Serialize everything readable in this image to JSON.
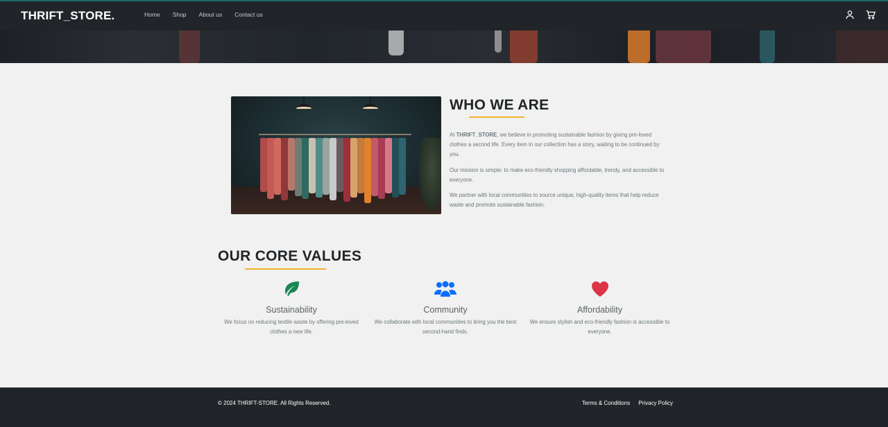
{
  "brand": "THRIFT_STORE.",
  "nav": {
    "links": [
      "Home",
      "Shop",
      "About us",
      "Contact us"
    ],
    "icons": [
      "user-icon",
      "cart-icon"
    ]
  },
  "about": {
    "title": "WHO WE ARE",
    "p1_prefix": "At ",
    "p1_brand": "THRIFT_STORE",
    "p1_rest": ", we believe in promoting sustainable fashion by giving pre-loved clothes a second life. Every item in our collection has a story, waiting to be continued by you.",
    "p2": "Our mission is simple: to make eco-friendly shopping affordable, trendy, and accessible to everyone.",
    "p3": "We partner with local communities to source unique, high-quality items that help reduce waste and promote sustainable fashion."
  },
  "values": {
    "title": "OUR CORE VALUES",
    "items": [
      {
        "title": "Sustainability",
        "text": "We focus on reducing textile waste by offering pre-loved clothes a new life.",
        "icon": "leaf-icon",
        "color": "#198754"
      },
      {
        "title": "Community",
        "text": "We collaborate with local communities to bring you the best second-hand finds.",
        "icon": "people-icon",
        "color": "#0d6efd"
      },
      {
        "title": "Affordability",
        "text": "We ensure stylish and eco-friendly fashion is accessible to everyone.",
        "icon": "heart-icon",
        "color": "#dc3545"
      }
    ]
  },
  "footer": {
    "copyright": "© 2024 THRIFT-STORE. All Rights Reserved.",
    "links": [
      "Terms & Conditions",
      "Privacy Policy"
    ]
  },
  "colors": {
    "accent": "#f0b429",
    "dark": "#212529"
  }
}
